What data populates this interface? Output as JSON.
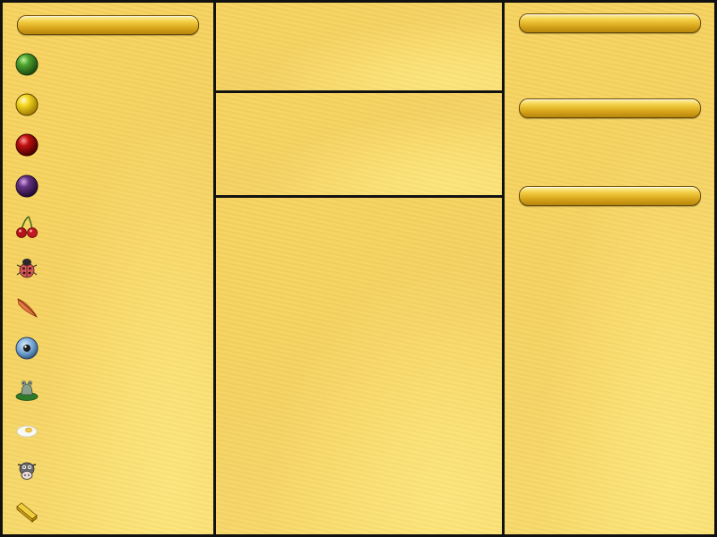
{
  "layout": {
    "left_panel": {
      "pill_label": "",
      "items": [
        {
          "icon": "green-ball-icon",
          "color": "#3f8f2a"
        },
        {
          "icon": "yellow-ball-icon",
          "color": "#f2d41c"
        },
        {
          "icon": "red-ball-icon",
          "color": "#b30c0c"
        },
        {
          "icon": "purple-ball-icon",
          "color": "#5b2b73"
        },
        {
          "icon": "cherries-icon",
          "color": "#b81d1d"
        },
        {
          "icon": "ladybug-icon",
          "color": "#c03a3a"
        },
        {
          "icon": "feather-icon",
          "color": "#d2582a"
        },
        {
          "icon": "eye-icon",
          "color": "#4f86b8"
        },
        {
          "icon": "frog-on-lilypad-icon",
          "color": "#3a7a2a"
        },
        {
          "icon": "fried-egg-icon",
          "color": "#f2f2f2"
        },
        {
          "icon": "cow-icon",
          "color": "#5a5a5a"
        },
        {
          "icon": "gold-bar-icon",
          "color": "#e0b21d"
        }
      ]
    },
    "right_panel": {
      "pill_labels": [
        "",
        "",
        ""
      ]
    }
  },
  "colors": {
    "panel": "#f6d35f",
    "border": "#111111",
    "pill": "#d9a71c"
  }
}
